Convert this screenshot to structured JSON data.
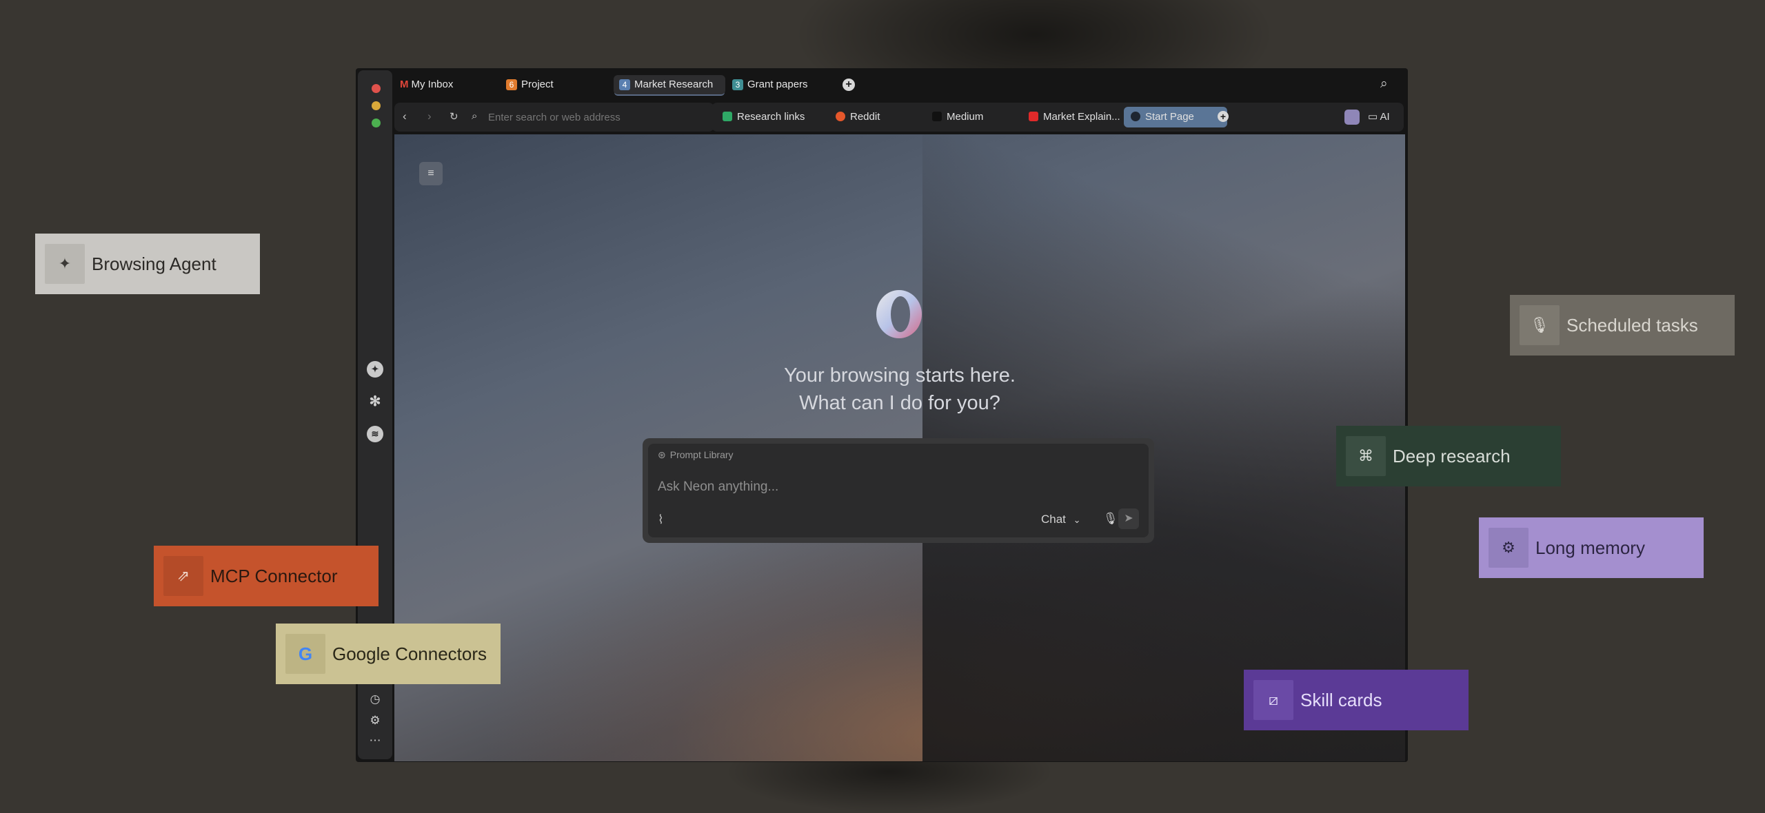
{
  "window_tabs": [
    {
      "label": "My Inbox",
      "badge": "",
      "icon": "gmail-icon",
      "badge_color": ""
    },
    {
      "label": "Project",
      "badge": "6",
      "icon": "workspace-badge",
      "badge_color": "#e07b2e"
    },
    {
      "label": "Market Research",
      "badge": "4",
      "icon": "workspace-badge",
      "badge_color": "#5a7fb0"
    },
    {
      "label": "Grant papers",
      "badge": "3",
      "icon": "workspace-badge",
      "badge_color": "#3f8e93"
    }
  ],
  "address_bar": {
    "placeholder": "Enter search or web address"
  },
  "page_tabs": [
    {
      "label": "Research links",
      "favicon_color": "#2fa866"
    },
    {
      "label": "Reddit",
      "favicon_color": "#e5572b"
    },
    {
      "label": "Medium",
      "favicon_color": "#111111"
    },
    {
      "label": "Market Explain...",
      "favicon_color": "#e02a2a"
    },
    {
      "label": "Start Page",
      "favicon_color": "#7c8da8"
    }
  ],
  "toolbar": {
    "ai_label": "AI"
  },
  "start_page": {
    "headline_line1": "Your browsing starts here.",
    "headline_line2": "What can I do for you?",
    "prompt_library": "Prompt Library",
    "prompt_placeholder": "Ask Neon anything...",
    "mode": "Chat"
  },
  "features": {
    "browsing_agent": "Browsing Agent",
    "scheduled_tasks": "Scheduled tasks",
    "deep_research": "Deep research",
    "long_memory": "Long memory",
    "mcp_connector": "MCP Connector",
    "google_connectors": "Google Connectors",
    "skill_cards": "Skill cards"
  },
  "feature_colors": {
    "browsing_agent": "#c9c7c3",
    "scheduled_tasks": "#6e6a62",
    "deep_research": "#2b3f33",
    "long_memory": "#a48fcf",
    "mcp_connector": "#c5532c",
    "google_connectors": "#cbc293",
    "skill_cards": "#5b3a96"
  }
}
